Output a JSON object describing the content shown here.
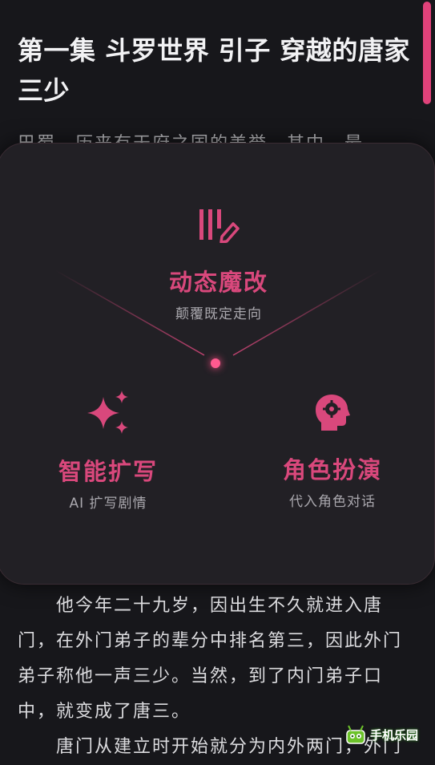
{
  "chapter": {
    "title": "第一集 斗罗世界 引子 穿越的唐家三少"
  },
  "reader": {
    "para_top": "巴蜀，历来有天府之国的美誉，其中，最",
    "para_main": "他今年二十九岁，因出生不久就进入唐门，在外门弟子的辈分中排名第三，因此外门弟子称他一声三少。当然，到了内门弟子口中，就变成了唐三。",
    "para_bottom": "唐门从建立时开始就分为内外两门，外门"
  },
  "features": {
    "dynamic": {
      "title": "动态魔改",
      "subtitle": "颠覆既定走向",
      "icon": "edit-pen-icon"
    },
    "expand": {
      "title": "智能扩写",
      "subtitle": "AI 扩写剧情",
      "icon": "sparkle-icon"
    },
    "roleplay": {
      "title": "角色扮演",
      "subtitle": "代入角色对话",
      "icon": "head-gear-icon"
    }
  },
  "watermark": {
    "text": "手机乐园"
  },
  "colors": {
    "accent": "#d9487c",
    "background": "#17171b",
    "card": "#222025"
  }
}
